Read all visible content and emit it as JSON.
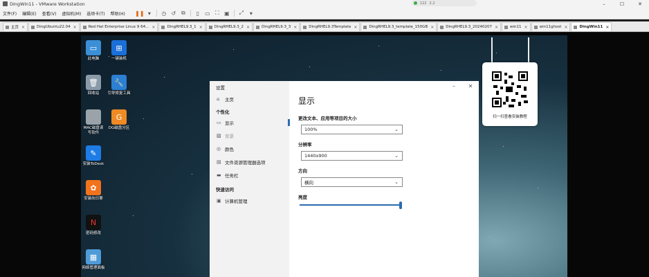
{
  "window": {
    "title": "DingWin11 - VMware Workstation"
  },
  "net": {
    "speed_up": "122",
    "speed_down": "2.2"
  },
  "menu": [
    "文件(F)",
    "编辑(E)",
    "查看(V)",
    "虚拟机(M)",
    "选项卡(T)",
    "帮助(H)"
  ],
  "tabs": [
    {
      "label": "主页"
    },
    {
      "label": "DingUbuntu22.04"
    },
    {
      "label": "Red Hat Enterprise Linux 9 64..."
    },
    {
      "label": "DingRHEL9.3_1"
    },
    {
      "label": "DingRHEL9.3_2"
    },
    {
      "label": "DingRHEL9.3_3"
    },
    {
      "label": "DingRHEL9.3Template"
    },
    {
      "label": "DingRHEL9.3_template_150GB"
    },
    {
      "label": "DingRHEL9.3_20240207"
    },
    {
      "label": "win11"
    },
    {
      "label": "win11ghost"
    },
    {
      "label": "DingWin11"
    }
  ],
  "desktop_icons": [
    {
      "label": "此电脑"
    },
    {
      "label": "一键装机"
    },
    {
      "label": "回收站"
    },
    {
      "label": "引导修复工具"
    },
    {
      "label": "MAC磁盘读写软件"
    },
    {
      "label": "DG磁盘分区"
    },
    {
      "label": "安装ToDesk"
    },
    {
      "label": "安装向日葵"
    },
    {
      "label": "密码修改"
    },
    {
      "label": "网络管理面板"
    }
  ],
  "qr_caption": "扫一扫查看安装教程",
  "settings": {
    "title": "设置",
    "home": "主页",
    "personalize_head": "个性化",
    "items": [
      "显示",
      "背景",
      "颜色",
      "文件资源管理器选项",
      "任务栏"
    ],
    "quick_head": "快速访问",
    "quick_items": [
      "计算机管理"
    ],
    "page_title": "显示",
    "scale_label": "更改文本、应用等项目的大小",
    "scale_value": "100%",
    "resolution_label": "分辨率",
    "resolution_value": "1440x900",
    "orientation_label": "方向",
    "orientation_value": "横向",
    "brightness_label": "亮度",
    "brightness_level": 1.0
  },
  "colors": {
    "accent": "#2b6cb0",
    "pause": "#e26b12"
  }
}
